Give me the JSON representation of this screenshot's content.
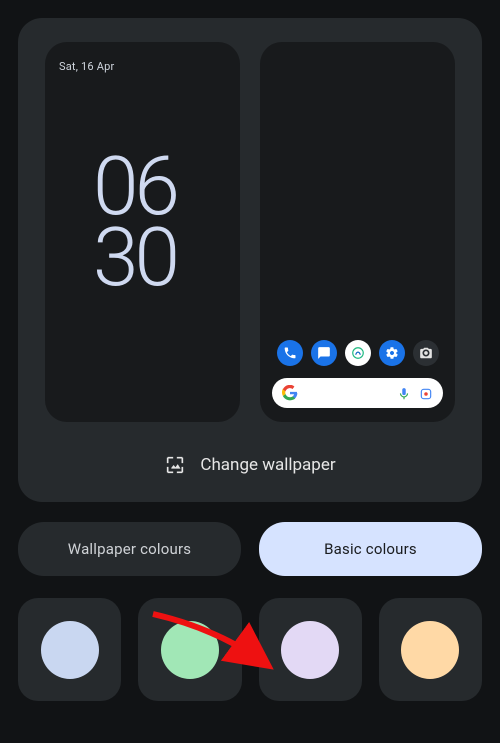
{
  "preview": {
    "lock": {
      "date": "Sat, 16 Apr",
      "clock_hh": "06",
      "clock_mm": "30"
    },
    "home": {
      "dock": [
        {
          "name": "phone-icon"
        },
        {
          "name": "messages-icon"
        },
        {
          "name": "browser-icon"
        },
        {
          "name": "settings-icon"
        },
        {
          "name": "camera-icon"
        }
      ]
    }
  },
  "change_wallpaper_label": "Change wallpaper",
  "tabs": {
    "wallpaper_colours": "Wallpaper colours",
    "basic_colours": "Basic colours",
    "active": "basic_colours"
  },
  "swatches": [
    {
      "name": "colour-blue",
      "hex": "#c9d7f1"
    },
    {
      "name": "colour-green",
      "hex": "#a1e7b6"
    },
    {
      "name": "colour-lilac",
      "hex": "#e3d9f5"
    },
    {
      "name": "colour-peach",
      "hex": "#ffd9a6"
    }
  ],
  "colors": {
    "accent_tab_bg": "#d6e3ff",
    "clock_color": "#cfd9f0"
  }
}
